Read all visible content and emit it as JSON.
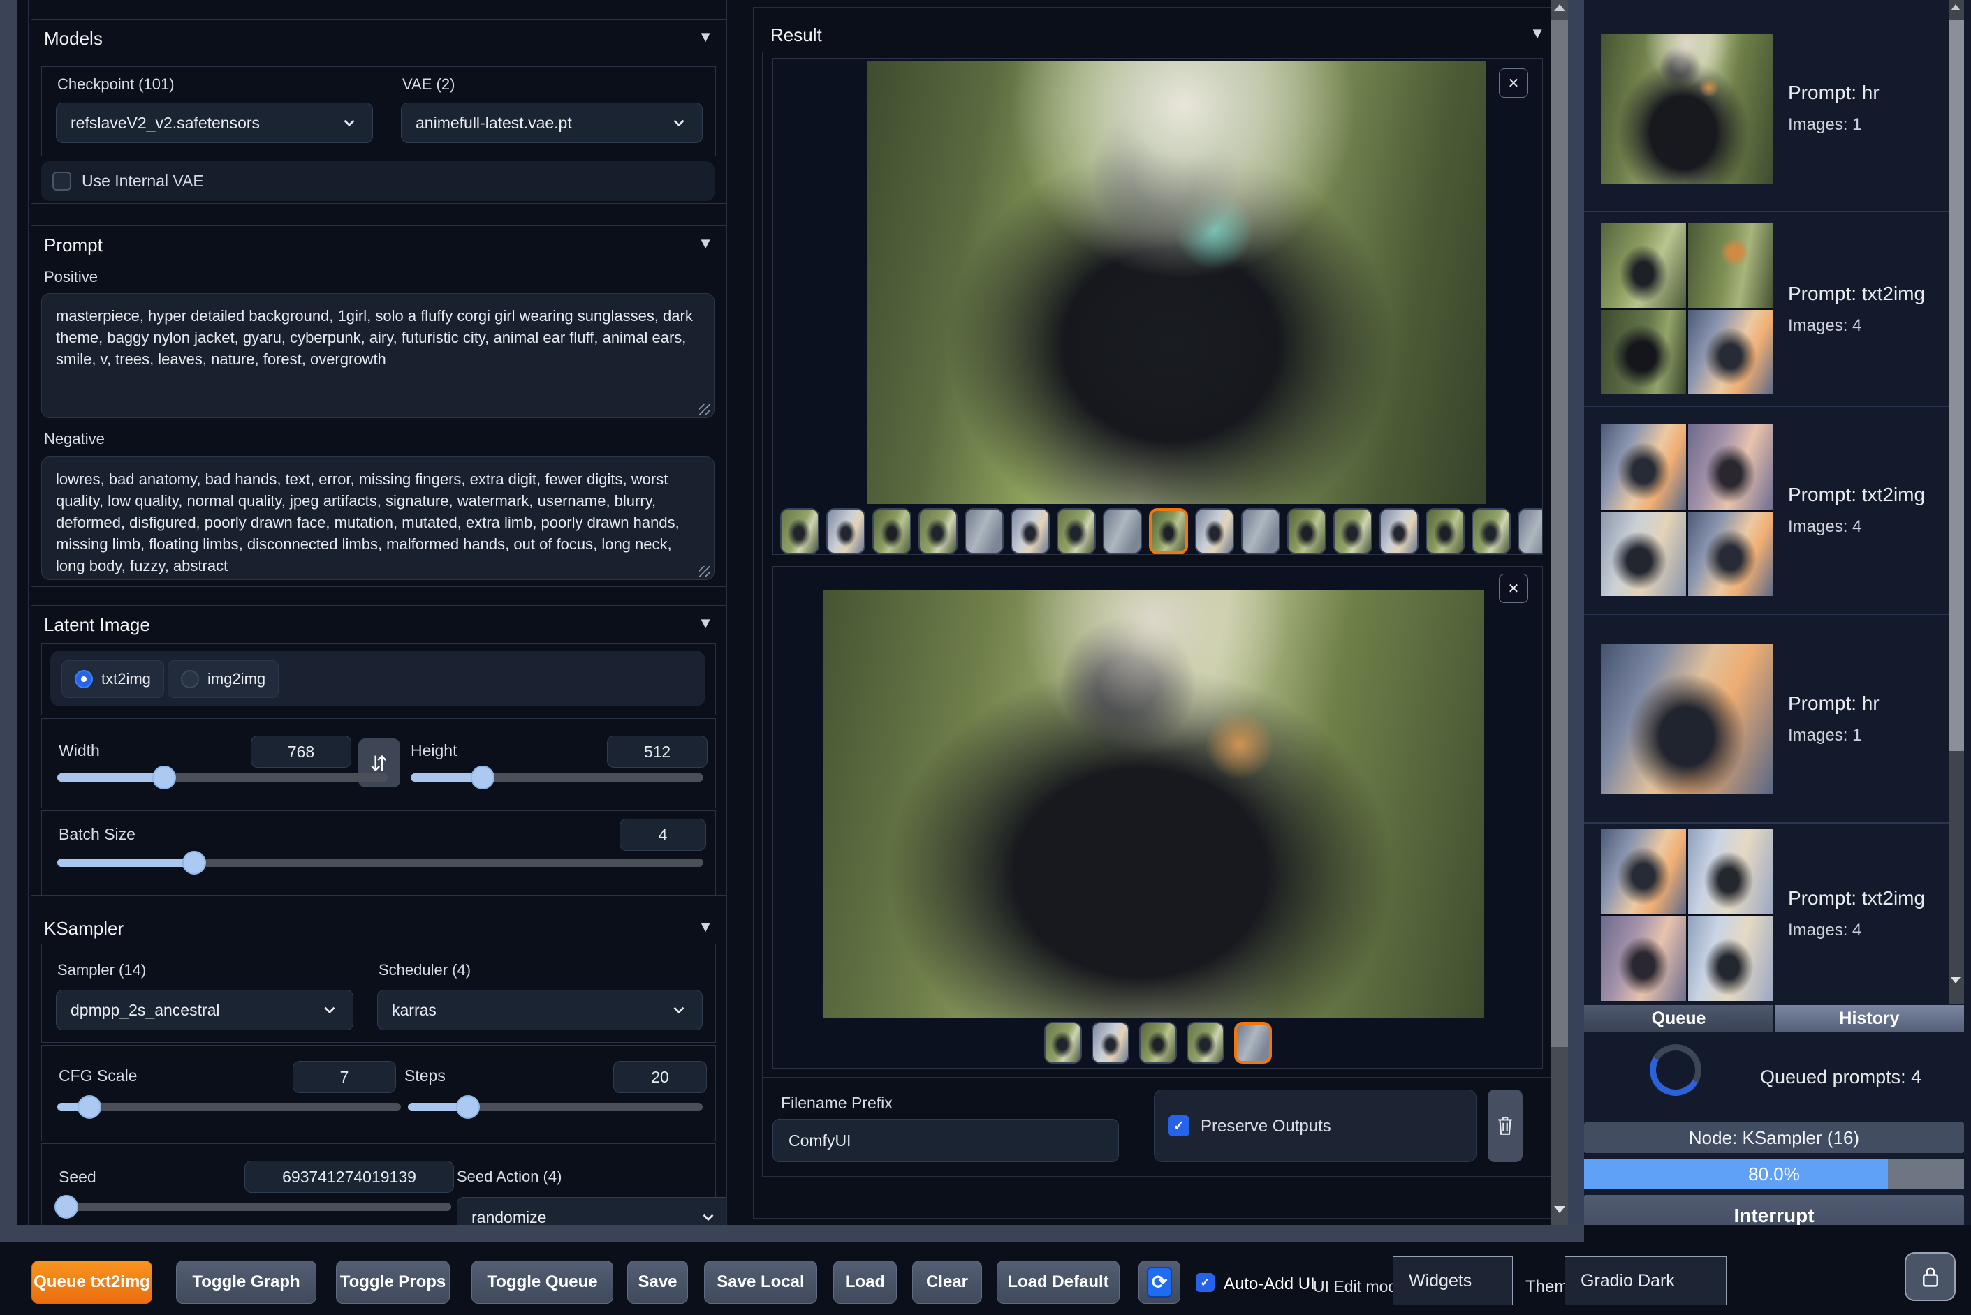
{
  "icons": {
    "collapse": "▼",
    "swap": "⇆",
    "close": "✕",
    "check": "✓",
    "refresh": "⟳",
    "scroll_up": "▲",
    "scroll_down": "▼"
  },
  "colors": {
    "accent_orange": "#f2760e",
    "accent_blue": "#2563eb",
    "progress_blue": "#5fa1f7"
  },
  "models": {
    "title": "Models",
    "checkpoint_label": "Checkpoint (101)",
    "checkpoint_value": "refslaveV2_v2.safetensors",
    "vae_label": "VAE (2)",
    "vae_value": "animefull-latest.vae.pt",
    "use_internal_vae_label": "Use Internal VAE"
  },
  "prompt": {
    "title": "Prompt",
    "positive_label": "Positive",
    "positive_value": "masterpiece, hyper detailed background, 1girl, solo a fluffy corgi girl wearing sunglasses, dark theme, baggy nylon jacket, gyaru, cyberpunk, airy, futuristic city, animal ear fluff, animal ears, smile, v, trees, leaves, nature, forest, overgrowth",
    "negative_label": "Negative",
    "negative_value": "lowres, bad anatomy, bad hands, text, error, missing fingers, extra digit, fewer digits, worst quality, low quality, normal quality, jpeg artifacts, signature, watermark, username, blurry, deformed, disfigured, poorly drawn face, mutation, mutated, extra limb, poorly drawn hands, missing limb, floating limbs, disconnected limbs, malformed hands, out of focus, long neck, long body, fuzzy, abstract"
  },
  "latent": {
    "title": "Latent Image",
    "mode_txt2img": "txt2img",
    "mode_img2img": "img2img",
    "width_label": "Width",
    "width_value": "768",
    "height_label": "Height",
    "height_value": "512",
    "batch_label": "Batch Size",
    "batch_value": "4"
  },
  "ksampler": {
    "title": "KSampler",
    "sampler_label": "Sampler (14)",
    "sampler_value": "dpmpp_2s_ancestral",
    "scheduler_label": "Scheduler (4)",
    "scheduler_value": "karras",
    "cfg_label": "CFG Scale",
    "cfg_value": "7",
    "steps_label": "Steps",
    "steps_value": "20",
    "seed_label": "Seed",
    "seed_value": "693741274019139",
    "seed_action_label": "Seed Action (4)",
    "seed_action_value": "randomize"
  },
  "result": {
    "title": "Result",
    "filename_label": "Filename Prefix",
    "filename_value": "ComfyUI",
    "preserve_label": "Preserve Outputs"
  },
  "sidebar": {
    "items": [
      {
        "prompt": "Prompt: hr",
        "images": "Images: 1"
      },
      {
        "prompt": "Prompt: txt2img",
        "images": "Images: 4"
      },
      {
        "prompt": "Prompt: txt2img",
        "images": "Images: 4"
      },
      {
        "prompt": "Prompt: hr",
        "images": "Images: 1"
      },
      {
        "prompt": "Prompt: txt2img",
        "images": "Images: 4"
      }
    ],
    "tab_queue": "Queue",
    "tab_history": "History",
    "queued": "Queued prompts: 4",
    "node": "Node: KSampler (16)",
    "progress_label": "80.0%",
    "progress_pct": 80,
    "interrupt": "Interrupt"
  },
  "toolbar": {
    "queue_txt2img": "Queue txt2img",
    "toggle_graph": "Toggle Graph",
    "toggle_props": "Toggle Props",
    "toggle_queue": "Toggle Queue",
    "save": "Save",
    "save_local": "Save Local",
    "load": "Load",
    "clear": "Clear",
    "load_default": "Load Default",
    "auto_add_ui": "Auto-Add UI",
    "ui_edit_mode": "UI Edit mode",
    "widgets": "Widgets",
    "theme_label": "Theme",
    "theme_value": "Gradio Dark"
  }
}
